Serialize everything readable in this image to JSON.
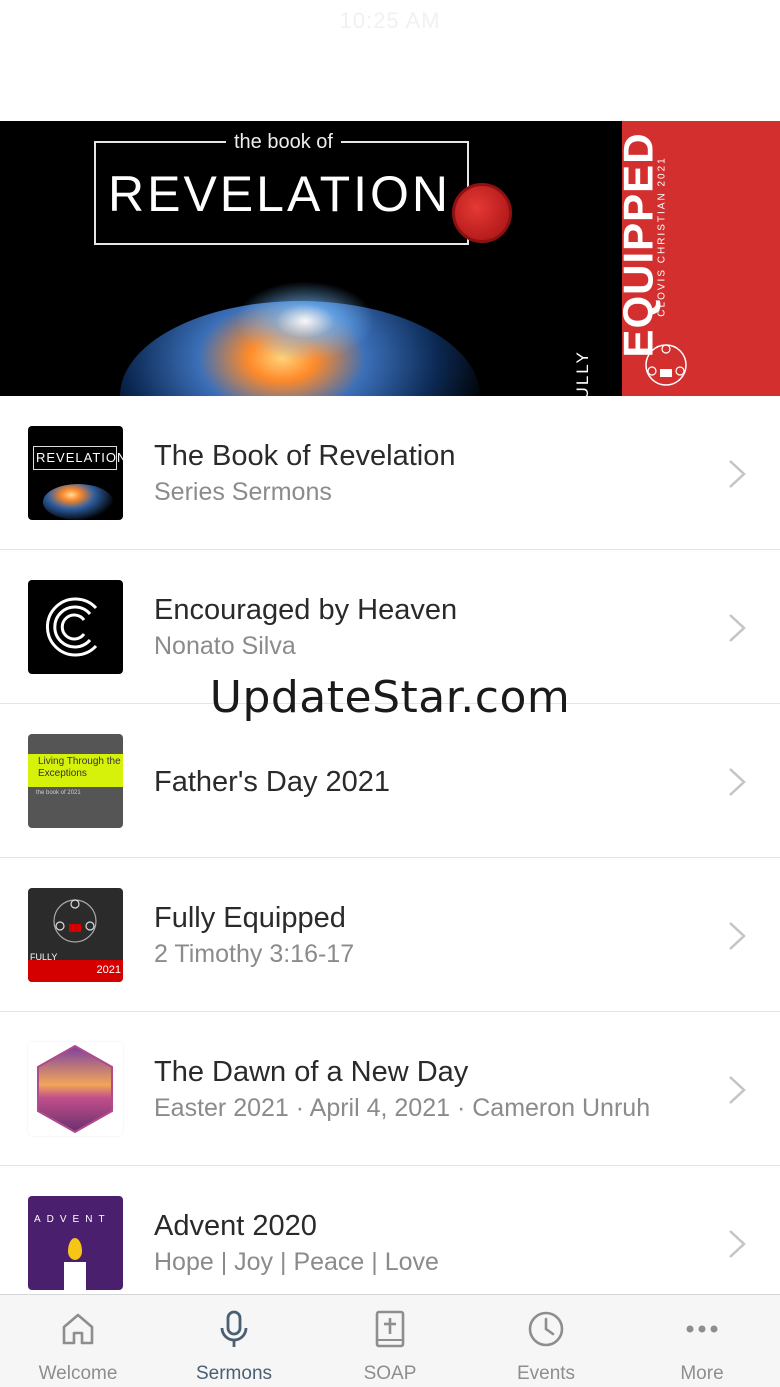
{
  "status_bar": {
    "time": "10:25 AM"
  },
  "banner": {
    "revelation": {
      "small": "the book of",
      "big": "REVELATION"
    },
    "fully_equipped": {
      "fully": "FULLY",
      "equipped": "EQUIPPED",
      "church": "CLOVIS CHRISTIAN 2021"
    }
  },
  "sermons": [
    {
      "title": "The Book of Revelation",
      "subtitle": "Series Sermons",
      "thumb_text": "REVELATION"
    },
    {
      "title": "Encouraged by Heaven",
      "subtitle": "Nonato Silva"
    },
    {
      "title": "Father's Day 2021",
      "subtitle": "",
      "thumb_text": "Living Through the Exceptions",
      "thumb_sub": "the book of 2021"
    },
    {
      "title": "Fully Equipped",
      "subtitle": "2 Timothy 3:16-17",
      "thumb_label": "FULLY",
      "thumb_year": "2021"
    },
    {
      "title": "The Dawn of a New Day",
      "subtitle": "Easter 2021 · April 4, 2021 · Cameron Unruh"
    },
    {
      "title": "Advent 2020",
      "subtitle": "Hope | Joy | Peace | Love",
      "thumb_text": "ADVENT"
    }
  ],
  "watermark": "UpdateStar.com",
  "tabs": [
    {
      "label": "Welcome",
      "icon": "home-icon",
      "active": false
    },
    {
      "label": "Sermons",
      "icon": "microphone-icon",
      "active": true
    },
    {
      "label": "SOAP",
      "icon": "bible-icon",
      "active": false
    },
    {
      "label": "Events",
      "icon": "clock-icon",
      "active": false
    },
    {
      "label": "More",
      "icon": "more-dots-icon",
      "active": false
    }
  ],
  "colors": {
    "accent_red": "#d32f2f",
    "active_tab": "#4a5f74",
    "inactive_tab": "#8e8e8e"
  }
}
